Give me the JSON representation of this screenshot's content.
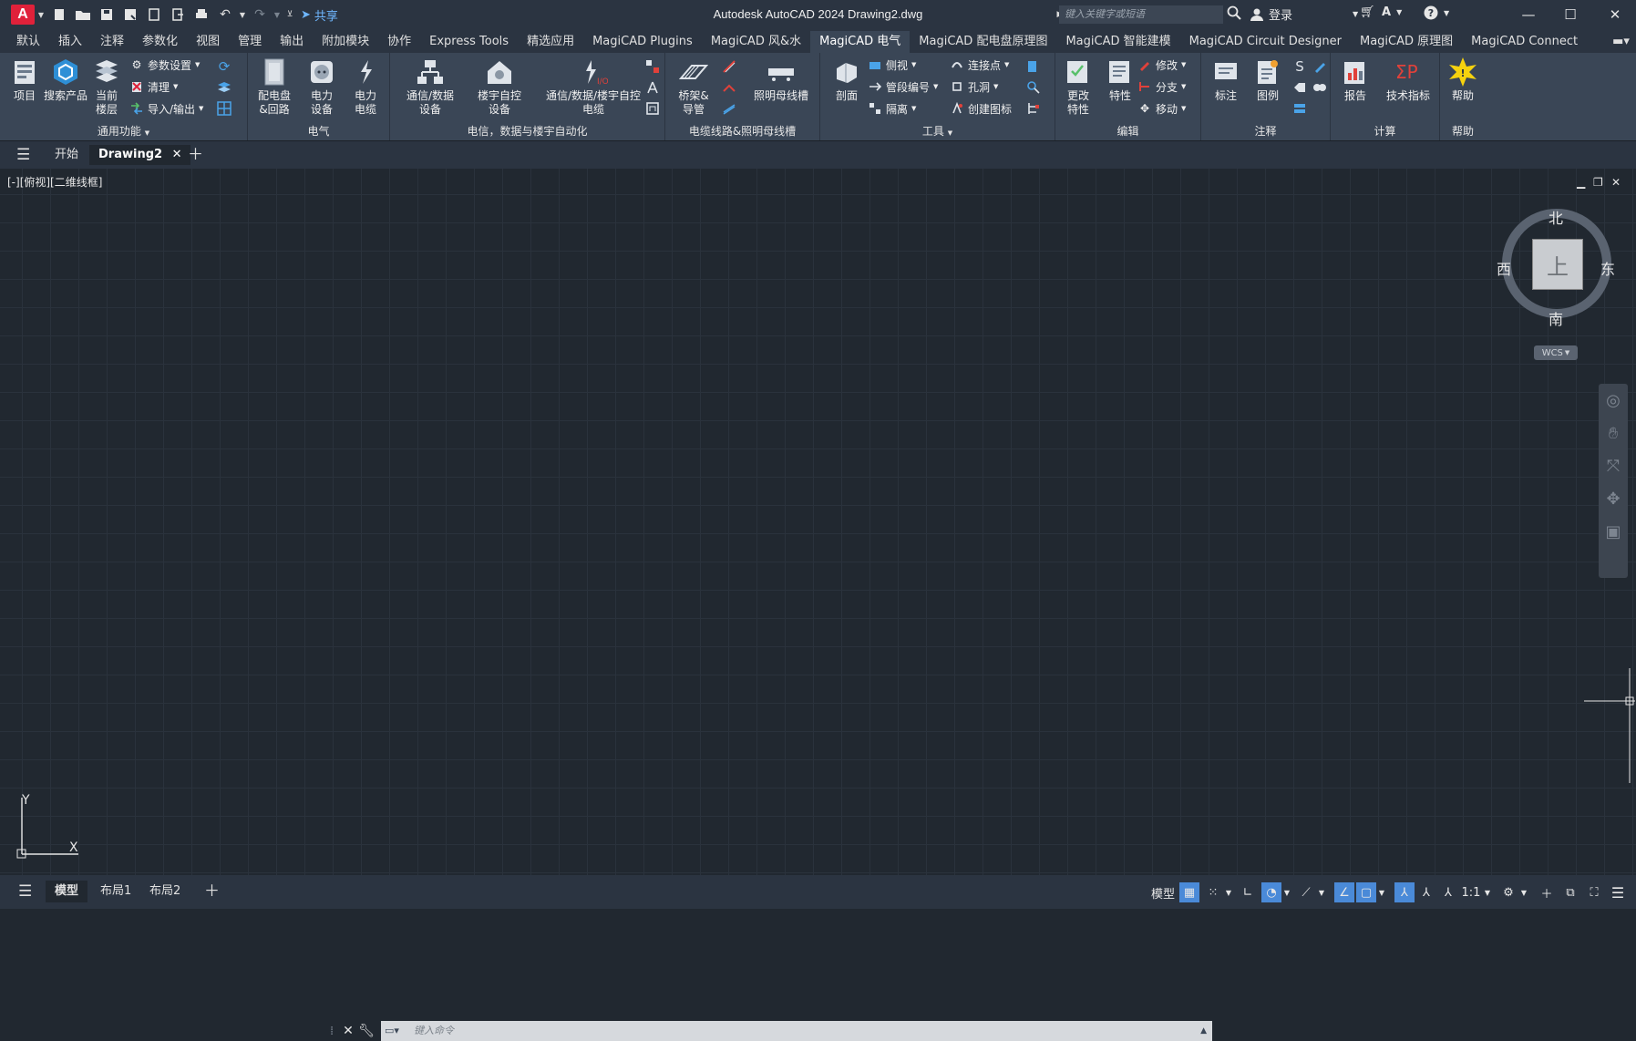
{
  "titlebar": {
    "app_logo": "A",
    "share_label": "共享",
    "title": "Autodesk AutoCAD 2024    Drawing2.dwg",
    "search_placeholder": "键入关键字或短语",
    "login_label": "登录"
  },
  "ribbon_tabs": [
    "默认",
    "插入",
    "注释",
    "参数化",
    "视图",
    "管理",
    "输出",
    "附加模块",
    "协作",
    "Express Tools",
    "精选应用",
    "MagiCAD Plugins",
    "MagiCAD 风&水",
    "MagiCAD 电气",
    "MagiCAD 配电盘原理图",
    "MagiCAD 智能建模",
    "MagiCAD Circuit Designer",
    "MagiCAD 原理图",
    "MagiCAD Connect"
  ],
  "active_tab": "MagiCAD 电气",
  "ribbon": {
    "general": {
      "title": "通用功能",
      "project": "项目",
      "search_product": "搜索产品",
      "current_floor": "当前\n楼层",
      "param_settings": "参数设置",
      "cleanup": "清理",
      "import_export": "导入/输出"
    },
    "electrical": {
      "title": "电气",
      "panel_circuit": "配电盘\n&回路",
      "power_device": "电力\n设备",
      "power_cable": "电力\n电缆"
    },
    "telecom": {
      "title": "电信，数据与楼宇自动化",
      "comm_device": "通信/数据\n设备",
      "bas_device": "楼宇自控\n设备",
      "comm_cable": "通信/数据/楼宇自控\n电缆"
    },
    "cable_route": {
      "title": "电缆线路&照明母线槽",
      "tray": "桥架&\n导管",
      "busway": "照明母线槽"
    },
    "tools": {
      "title": "工具",
      "section": "剖面",
      "side_view": "侧视",
      "pipe_number": "管段编号",
      "isolate": "隔离",
      "connect_point": "连接点",
      "hole": "孔洞",
      "create_symbol": "创建图标"
    },
    "edit": {
      "title": "编辑",
      "change_props": "更改\n特性",
      "props": "特性",
      "modify": "修改",
      "branch": "分支",
      "move": "移动"
    },
    "annotation": {
      "title": "注释",
      "dimension": "标注",
      "legend": "图例"
    },
    "calc": {
      "title": "计算",
      "report": "报告",
      "tech_index": "技术指标"
    },
    "help": {
      "title": "帮助",
      "help": "帮助"
    }
  },
  "file_tabs": {
    "start": "开始",
    "drawing": "Drawing2"
  },
  "viewport": {
    "label": "[-][俯视][二维线框]",
    "compass": {
      "north": "北",
      "south": "南",
      "east": "东",
      "west": "西",
      "face": "上"
    },
    "wcs": "WCS",
    "ucs_x": "X",
    "ucs_y": "Y"
  },
  "command": {
    "placeholder": "键入命令"
  },
  "layout_tabs": [
    "模型",
    "布局1",
    "布局2"
  ],
  "status": {
    "model": "模型",
    "scale": "1:1"
  },
  "colors": {
    "background": "#212830",
    "ribbon": "#3a4656",
    "chrome": "#2b3441",
    "accent_logo": "#e0213a",
    "active_status_icon": "#4a8ad8"
  }
}
